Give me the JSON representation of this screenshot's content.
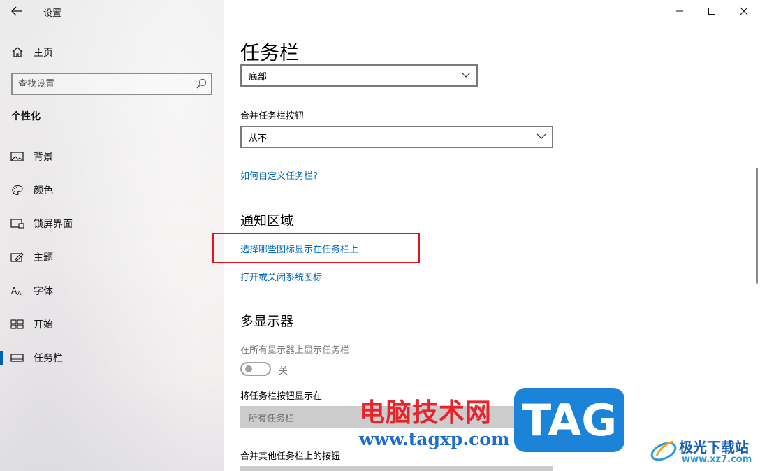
{
  "window": {
    "app_title": "设置",
    "back_icon": "back-arrow-icon",
    "controls": {
      "minimize_icon": "minimize-icon",
      "maximize_icon": "maximize-icon",
      "close_icon": "close-icon"
    }
  },
  "sidebar": {
    "home_label": "主页",
    "search_placeholder": "查找设置",
    "section_header": "个性化",
    "items": [
      {
        "label": "背景",
        "icon": "picture-icon"
      },
      {
        "label": "颜色",
        "icon": "palette-icon"
      },
      {
        "label": "锁屏界面",
        "icon": "lockscreen-icon"
      },
      {
        "label": "主题",
        "icon": "theme-brush-icon"
      },
      {
        "label": "字体",
        "icon": "font-icon"
      },
      {
        "label": "开始",
        "icon": "start-tiles-icon"
      },
      {
        "label": "任务栏",
        "icon": "taskbar-icon",
        "active": true
      }
    ],
    "accent_color": "#0063b1"
  },
  "main": {
    "page_title": "任务栏",
    "location_select_value": "底部",
    "combine_label": "合并任务栏按钮",
    "combine_select_value": "从不",
    "customize_link": "如何自定义任务栏?",
    "notification_title": "通知区域",
    "choose_icons_link": "选择哪些图标显示在任务栏上",
    "system_icons_link": "打开或关闭系统图标",
    "multi_display_title": "多显示器",
    "show_on_all_label": "在所有显示器上显示任务栏",
    "toggle_state": "关",
    "show_buttons_label": "将任务栏按钮显示在",
    "show_buttons_value": "所有任务栏",
    "combine_other_label": "合并其他任务栏上的按钮",
    "link_color": "#0067c0",
    "highlight_color": "#e0141e"
  },
  "watermark": {
    "site_cn": "电脑技术网",
    "site_url": "www.tagxp.com",
    "tag": "TAG",
    "xz_cn": "极光下载站",
    "xz_url": "www.xz7.com"
  }
}
